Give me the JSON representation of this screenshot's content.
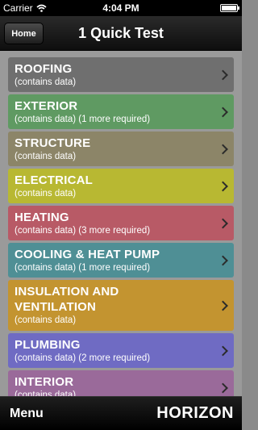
{
  "status_bar": {
    "carrier": "Carrier",
    "time": "4:04 PM"
  },
  "navbar": {
    "home_label": "Home",
    "title": "1 Quick Test"
  },
  "items": [
    {
      "title": "ROOFING",
      "subtitle": "(contains data)",
      "color": "#6f6f6f"
    },
    {
      "title": "EXTERIOR",
      "subtitle": "(contains data) (1 more required)",
      "color": "#5f9a62"
    },
    {
      "title": "STRUCTURE",
      "subtitle": "(contains data)",
      "color": "#8c8568"
    },
    {
      "title": "ELECTRICAL",
      "subtitle": "(contains data)",
      "color": "#b8b832"
    },
    {
      "title": "HEATING",
      "subtitle": "(contains data) (3 more required)",
      "color": "#b85a66"
    },
    {
      "title": "COOLING & HEAT PUMP",
      "subtitle": "(contains data) (1 more required)",
      "color": "#4f8f95"
    },
    {
      "title": "INSULATION AND VENTILATION",
      "subtitle": "(contains data)",
      "color": "#c39430"
    },
    {
      "title": "PLUMBING",
      "subtitle": "(contains data) (2 more required)",
      "color": "#6f6bc3"
    },
    {
      "title": "INTERIOR",
      "subtitle": "(contains data)",
      "color": "#9a6a9a"
    }
  ],
  "bottom_bar": {
    "menu_label": "Menu",
    "logo_text": "HORIZON"
  }
}
